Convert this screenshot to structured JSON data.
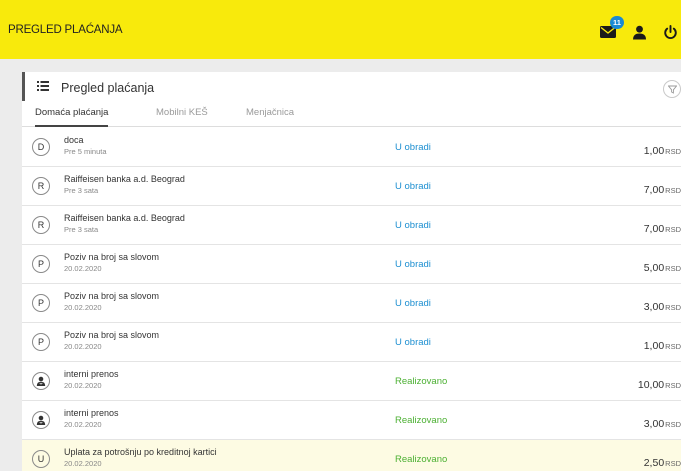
{
  "header": {
    "title": "PREGLED PLAĆANJA",
    "message_count": "11",
    "icons": [
      "envelope-icon",
      "user-icon",
      "power-icon"
    ]
  },
  "panel": {
    "title": "Pregled plaćanja",
    "icons": [
      "list-icon",
      "filter-icon"
    ]
  },
  "tabs": [
    {
      "label": "Domaća plaćanja",
      "active": true
    },
    {
      "label": "Mobilni KEŠ",
      "active": false
    },
    {
      "label": "Menjačnica",
      "active": false
    }
  ],
  "payments": [
    {
      "initial": "D",
      "name": "doca",
      "date": "Pre 5 minuta",
      "status": "U obradi",
      "amount": "1,00",
      "currency": "RSD"
    },
    {
      "initial": "R",
      "name": "Raiffeisen banka a.d. Beograd",
      "date": "Pre 3 sata",
      "status": "U obradi",
      "amount": "7,00",
      "currency": "RSD"
    },
    {
      "initial": "R",
      "name": "Raiffeisen banka a.d. Beograd",
      "date": "Pre 3 sata",
      "status": "U obradi",
      "amount": "7,00",
      "currency": "RSD"
    },
    {
      "initial": "P",
      "name": "Poziv na broj sa slovom",
      "date": "20.02.2020",
      "status": "U obradi",
      "amount": "5,00",
      "currency": "RSD"
    },
    {
      "initial": "P",
      "name": "Poziv na broj sa slovom",
      "date": "20.02.2020",
      "status": "U obradi",
      "amount": "3,00",
      "currency": "RSD"
    },
    {
      "initial": "P",
      "name": "Poziv na broj sa slovom",
      "date": "20.02.2020",
      "status": "U obradi",
      "amount": "1,00",
      "currency": "RSD"
    },
    {
      "initial": "",
      "icon": "person-icon",
      "name": "interni prenos",
      "date": "20.02.2020",
      "status": "Realizovano",
      "amount": "10,00",
      "currency": "RSD"
    },
    {
      "initial": "",
      "icon": "person-icon",
      "name": "interni prenos",
      "date": "20.02.2020",
      "status": "Realizovano",
      "amount": "3,00",
      "currency": "RSD"
    },
    {
      "initial": "U",
      "name": "Uplata za potrošnju po kreditnoj kartici",
      "date": "20.02.2020",
      "status": "Realizovano",
      "amount": "2,50",
      "currency": "RSD",
      "highlight": true
    }
  ],
  "colors": {
    "header_bg": "#f8ea0c",
    "status_processing": "#1d8fd1",
    "status_done": "#4cb033",
    "badge": "#1a8ad4",
    "highlight_row": "#fdfbe3"
  }
}
